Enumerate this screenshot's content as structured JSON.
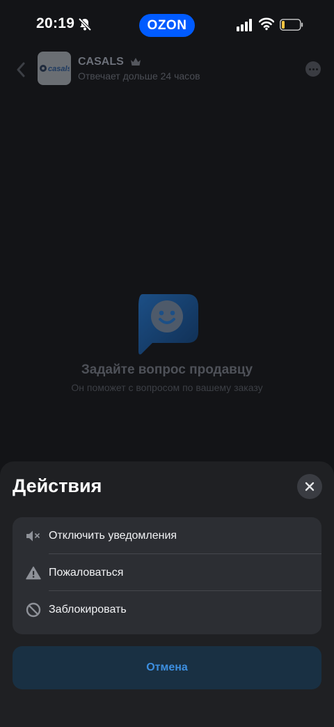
{
  "status_bar": {
    "time": "20:19",
    "brand": "OZON",
    "brand_color": "#005bff"
  },
  "chat_header": {
    "seller_name": "CASALS",
    "seller_status": "Отвечает дольше 24 часов",
    "avatar_logo_text": "casals",
    "icons": [
      "back-arrow-icon",
      "crown-icon",
      "more-icon"
    ]
  },
  "empty_state": {
    "title": "Задайте вопрос продавцу",
    "subtitle": "Он поможет с вопросом по вашему заказу",
    "icon": "smiley-chat-bubble-icon"
  },
  "action_sheet": {
    "title": "Действия",
    "items": [
      {
        "label": "Отключить уведомления",
        "icon": "speaker-mute-icon"
      },
      {
        "label": "Пожаловаться",
        "icon": "warning-icon"
      },
      {
        "label": "Заблокировать",
        "icon": "block-icon"
      }
    ],
    "cancel_label": "Отмена",
    "accent_color": "#3d8fe0"
  }
}
